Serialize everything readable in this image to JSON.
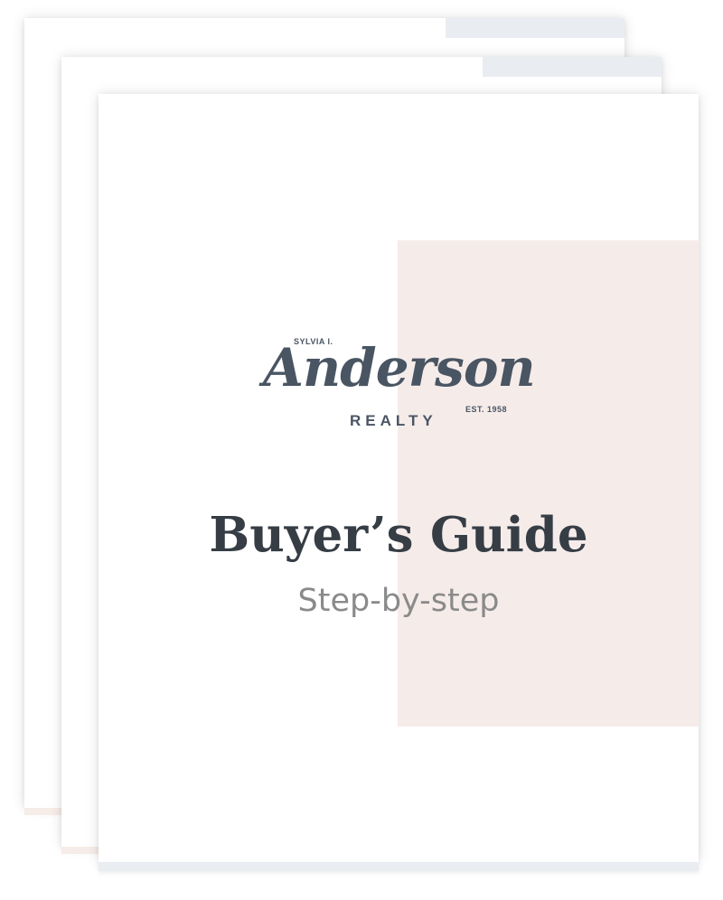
{
  "logo": {
    "top_text": "SYLVIA I.",
    "name": "Anderson",
    "realty": "REALTY",
    "established": "EST. 1958"
  },
  "document": {
    "title": "Buyer’s Guide",
    "subtitle": "Step-by-step"
  },
  "colors": {
    "accent_panel": "#f5ecea",
    "logo_text": "#4a5563",
    "title_text": "#363d45",
    "subtitle_text": "#8a8a8a"
  }
}
